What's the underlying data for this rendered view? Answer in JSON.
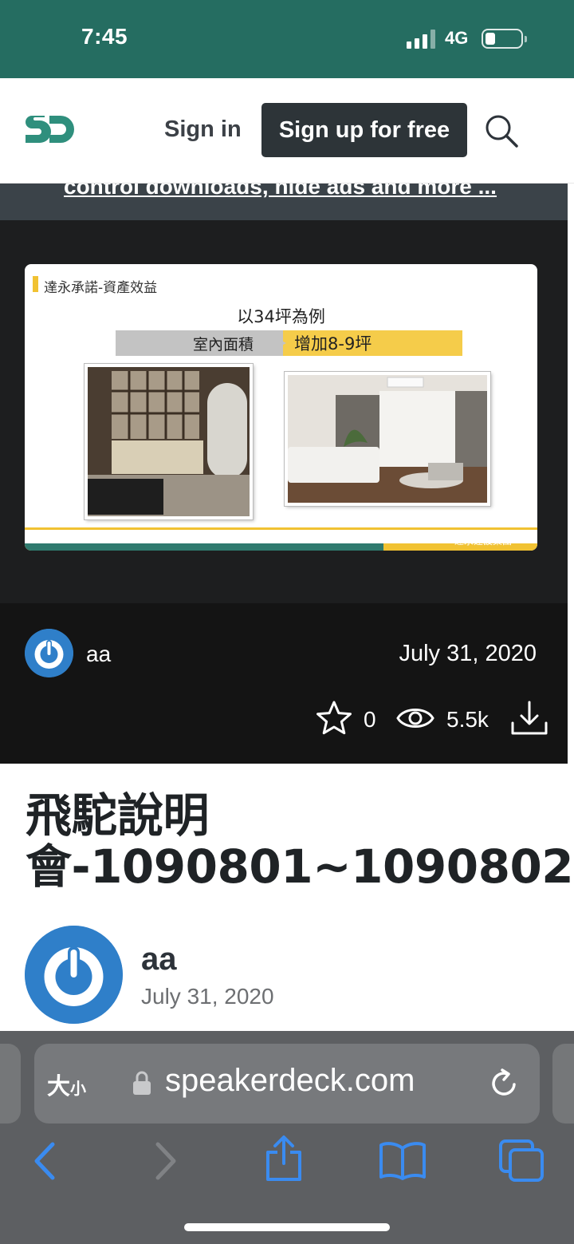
{
  "status_bar": {
    "time": "7:45",
    "network": "4G"
  },
  "header": {
    "logo": "SD",
    "sign_in": "Sign in",
    "sign_up": "Sign up for free"
  },
  "promo": {
    "link_text": "control downloads, hide ads and more ..."
  },
  "slide": {
    "heading": "達永承諾-資產效益",
    "example": "以34坪為例",
    "label_left": "室內面積",
    "label_right": "增加8-9坪",
    "footer": "達永建設集團",
    "progress_fraction": 0.7
  },
  "meta": {
    "author": "aa",
    "date": "July 31, 2020",
    "stars": "0",
    "views": "5.5k"
  },
  "deck": {
    "title": "飛駝說明會-1090801~1090802",
    "author": "aa",
    "date": "July 31, 2020"
  },
  "safari": {
    "text_size": "大",
    "text_size_small": "小",
    "url": "speakerdeck.com"
  },
  "colors": {
    "brand": "#256d61",
    "accent": "#f1c232"
  },
  "icons": [
    "signal-icon",
    "battery-icon",
    "logo-icon",
    "search-icon",
    "star-icon",
    "eye-icon",
    "download-icon",
    "lock-icon",
    "reload-icon",
    "back-icon",
    "forward-icon",
    "share-icon",
    "bookmarks-icon",
    "tabs-icon"
  ]
}
